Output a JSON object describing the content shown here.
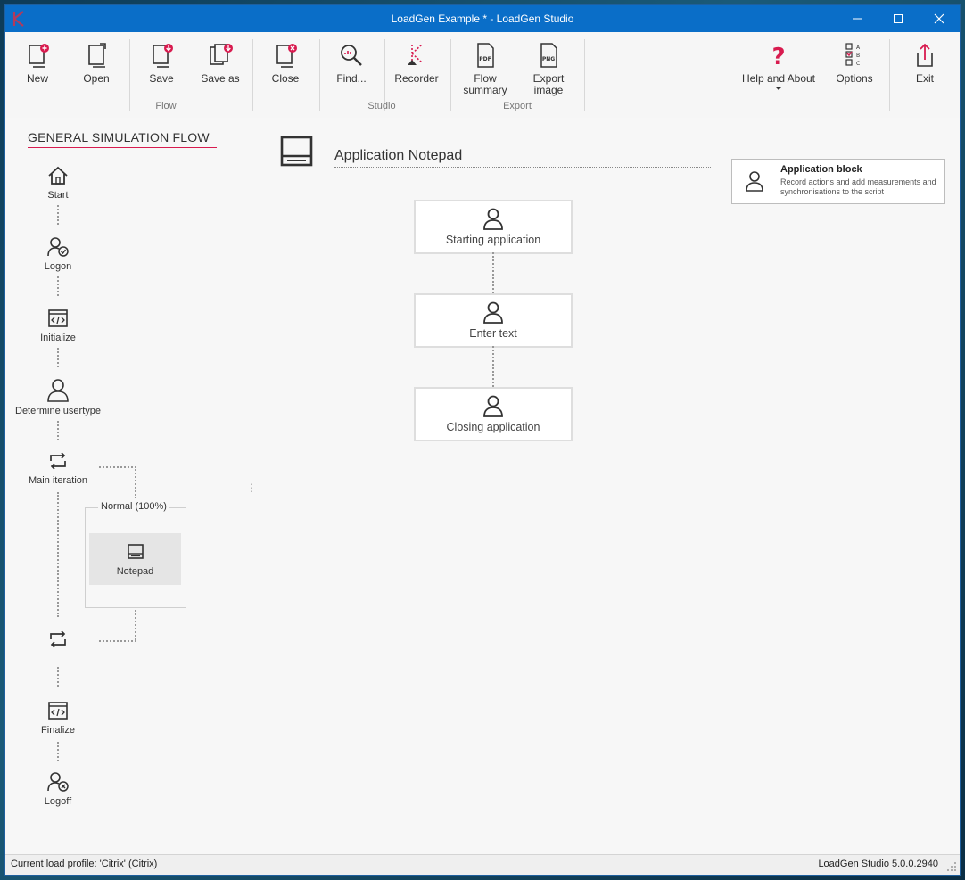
{
  "window": {
    "title": "LoadGen Example * - LoadGen Studio"
  },
  "ribbon": {
    "buttons": {
      "new": "New",
      "open": "Open",
      "save": "Save",
      "save_as": "Save as",
      "close": "Close",
      "find": "Find...",
      "recorder": "Recorder",
      "flow_summary": "Flow summary",
      "export_image": "Export image",
      "help_about": "Help and About",
      "options": "Options",
      "exit": "Exit"
    },
    "groups": {
      "flow": "Flow",
      "studio": "Studio",
      "export": "Export"
    }
  },
  "flow": {
    "title": "GENERAL SIMULATION FLOW",
    "nodes": {
      "start": "Start",
      "logon": "Logon",
      "initialize": "Initialize",
      "determine_usertype": "Determine usertype",
      "main_iteration": "Main iteration",
      "finalize": "Finalize",
      "logoff": "Logoff"
    },
    "branch": {
      "label": "Normal (100%)",
      "block": "Notepad"
    }
  },
  "canvas": {
    "title": "Application Notepad",
    "blocks": [
      "Starting application",
      "Enter text",
      "Closing application"
    ]
  },
  "info_card": {
    "title": "Application block",
    "description": "Record actions and add measurements and synchronisations to the script"
  },
  "status": {
    "left": "Current load profile: 'Citrix' (Citrix)",
    "right": "LoadGen Studio 5.0.0.2940"
  },
  "colors": {
    "titlebar": "#0a6ec8",
    "accent": "#d81b4f"
  }
}
